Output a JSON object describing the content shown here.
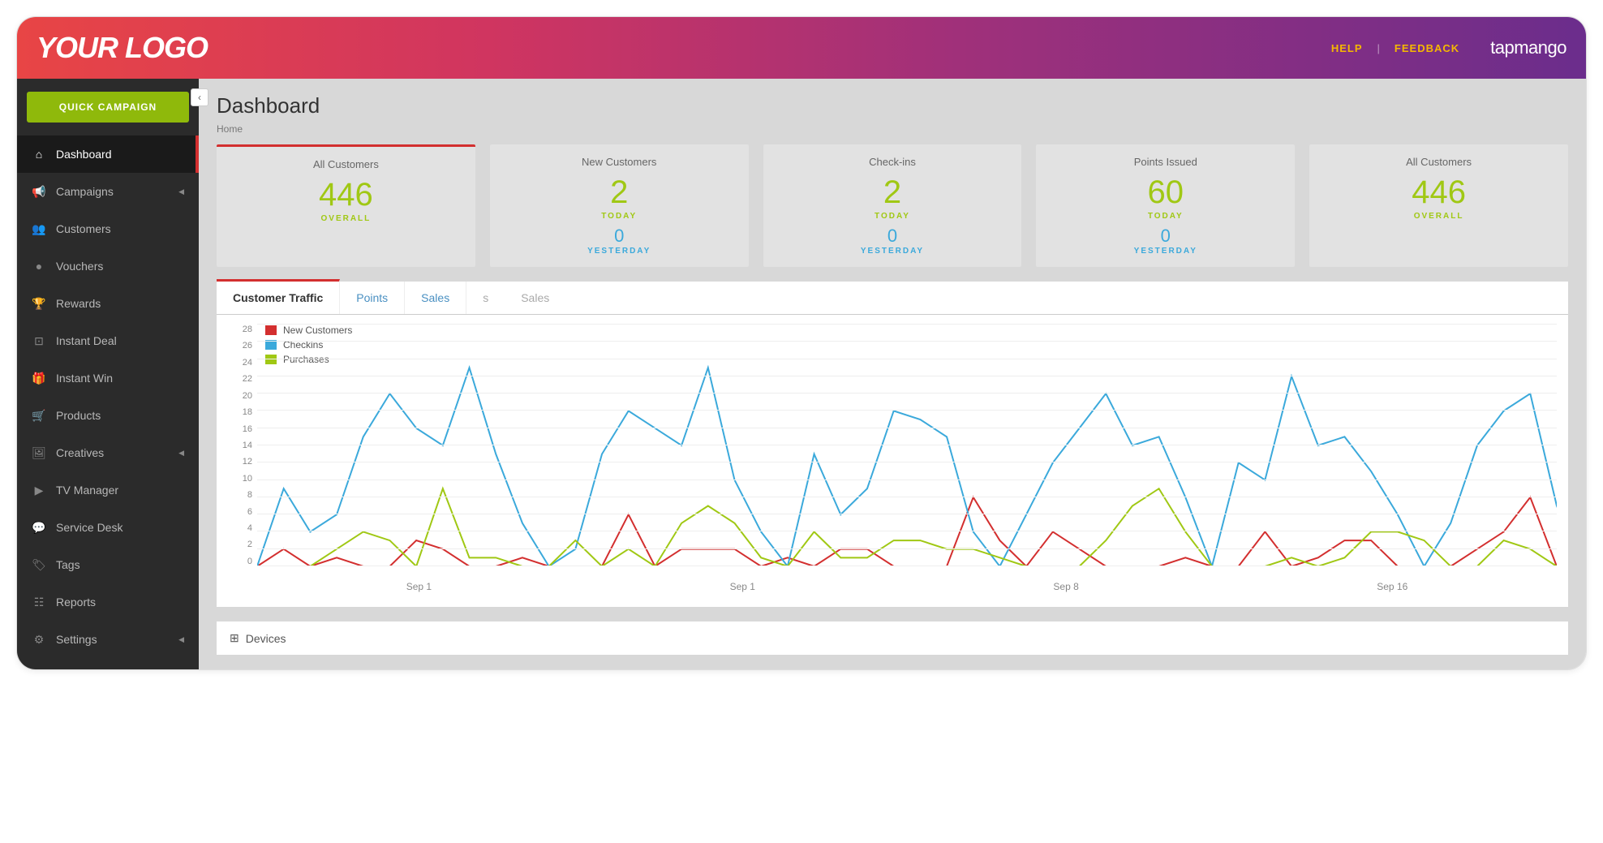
{
  "header": {
    "logo": "YOUR LOGO",
    "help": "HELP",
    "feedback": "FEEDBACK",
    "brand": "tapmango"
  },
  "sidebar": {
    "quick": "QUICK CAMPAIGN",
    "items": [
      {
        "label": "Dashboard",
        "icon": "⌂",
        "active": true
      },
      {
        "label": "Campaigns",
        "icon": "📢",
        "caret": true
      },
      {
        "label": "Customers",
        "icon": "👥"
      },
      {
        "label": "Vouchers",
        "icon": "●"
      },
      {
        "label": "Rewards",
        "icon": "🏆"
      },
      {
        "label": "Instant Deal",
        "icon": "⊡"
      },
      {
        "label": "Instant Win",
        "icon": "🎁"
      },
      {
        "label": "Products",
        "icon": "🛒"
      },
      {
        "label": "Creatives",
        "icon": "🖼",
        "caret": true
      },
      {
        "label": "TV Manager",
        "icon": "▶"
      },
      {
        "label": "Service Desk",
        "icon": "💬"
      },
      {
        "label": "Tags",
        "icon": "🏷"
      },
      {
        "label": "Reports",
        "icon": "☷"
      },
      {
        "label": "Settings",
        "icon": "⚙",
        "caret": true
      }
    ]
  },
  "page": {
    "title": "Dashboard",
    "breadcrumb": "Home"
  },
  "cards": [
    {
      "title": "All Customers",
      "val": "446",
      "sub1": "OVERALL"
    },
    {
      "title": "New Customers",
      "val": "2",
      "sub1": "TODAY",
      "val2": "0",
      "sub2": "YESTERDAY"
    },
    {
      "title": "Check-ins",
      "val": "2",
      "sub1": "TODAY",
      "val2": "0",
      "sub2": "YESTERDAY"
    },
    {
      "title": "Points Issued",
      "val": "60",
      "sub1": "TODAY",
      "val2": "0",
      "sub2": "YESTERDAY"
    },
    {
      "title": "All Customers",
      "val": "446",
      "sub1": "OVERALL"
    }
  ],
  "tabs": [
    "Customer Traffic",
    "Points",
    "Sales"
  ],
  "tabs_ghost": [
    "s",
    "Sales"
  ],
  "devices": "Devices",
  "chart_data": {
    "type": "line",
    "title": "Customer Traffic",
    "ylabel": "",
    "xlabel": "",
    "ylim": [
      0,
      28
    ],
    "yticks": [
      0,
      2,
      4,
      6,
      8,
      10,
      12,
      14,
      16,
      18,
      20,
      22,
      24,
      26,
      28
    ],
    "xticks": [
      "Sep 1",
      "Sep 1",
      "Sep 8",
      "Sep 16"
    ],
    "series": [
      {
        "name": "New Customers",
        "color": "#d32f2f",
        "values": [
          0,
          2,
          0,
          1,
          0,
          0,
          3,
          2,
          0,
          0,
          1,
          0,
          0,
          0,
          6,
          0,
          2,
          2,
          2,
          0,
          1,
          0,
          2,
          2,
          0,
          0,
          0,
          8,
          3,
          0,
          4,
          2,
          0,
          0,
          0,
          1,
          0,
          0,
          4,
          0,
          1,
          3,
          3,
          0,
          0,
          0,
          2,
          4,
          8,
          0
        ]
      },
      {
        "name": "Checkins",
        "color": "#3ba9db",
        "values": [
          0,
          9,
          4,
          6,
          15,
          20,
          16,
          14,
          23,
          13,
          5,
          0,
          2,
          13,
          18,
          16,
          14,
          23,
          10,
          4,
          0,
          13,
          6,
          9,
          18,
          17,
          15,
          4,
          0,
          6,
          12,
          16,
          20,
          14,
          15,
          8,
          0,
          12,
          10,
          22,
          14,
          15,
          11,
          6,
          0,
          5,
          14,
          18,
          20,
          7,
          0
        ]
      },
      {
        "name": "Purchases",
        "color": "#a0c814",
        "values": [
          0,
          0,
          0,
          2,
          4,
          3,
          0,
          9,
          1,
          1,
          0,
          0,
          3,
          0,
          2,
          0,
          5,
          7,
          5,
          1,
          0,
          4,
          1,
          1,
          3,
          3,
          2,
          2,
          1,
          0,
          0,
          0,
          3,
          7,
          9,
          4,
          0,
          0,
          0,
          1,
          0,
          1,
          4,
          4,
          3,
          0,
          0,
          3,
          2,
          0
        ]
      }
    ]
  }
}
